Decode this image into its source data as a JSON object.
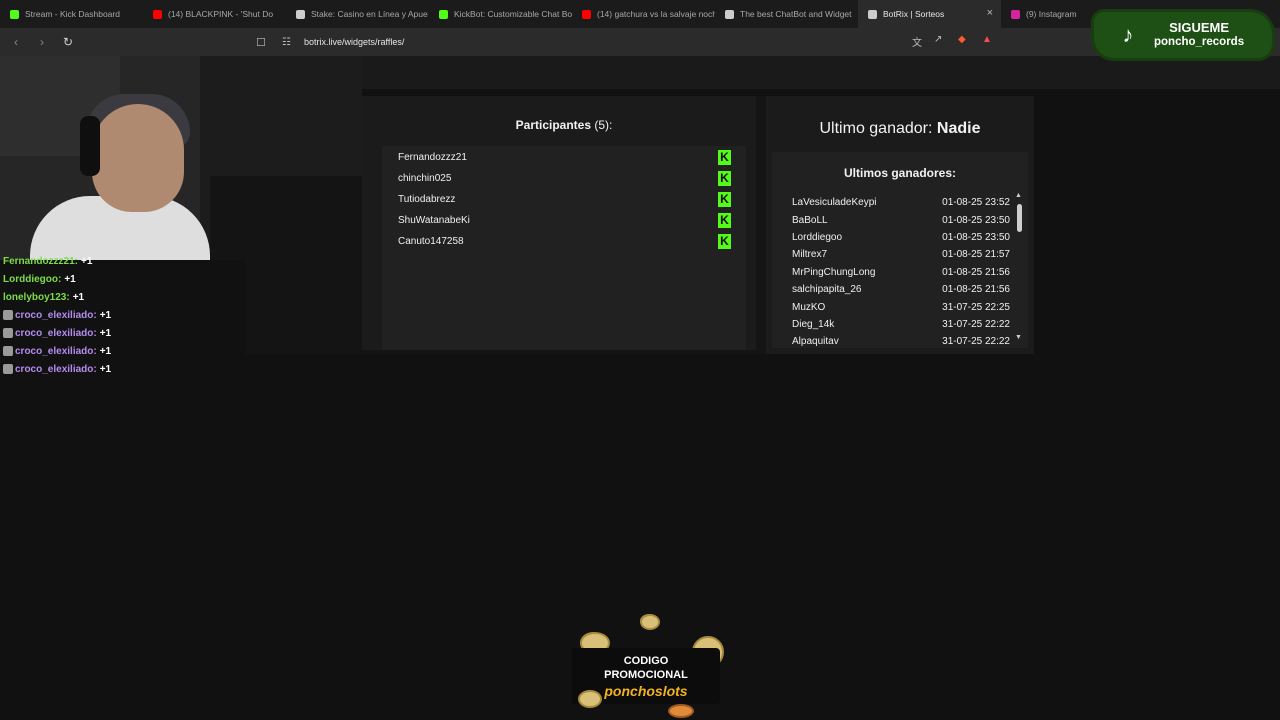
{
  "browser": {
    "tabs": [
      {
        "label": "Stream - Kick Dashboard",
        "icon": "kick-icon",
        "color": "#53fc18"
      },
      {
        "label": "(14) BLACKPINK - 'Shut Do",
        "icon": "youtube-icon",
        "color": "#ff0000"
      },
      {
        "label": "Stake: Casino en Línea y Apue",
        "icon": "stake-icon",
        "color": "#cccccc"
      },
      {
        "label": "KickBot: Customizable Chat Bo",
        "icon": "kickbot-icon",
        "color": "#53fc18"
      },
      {
        "label": "(14) gatchura vs la salvaje noch",
        "icon": "youtube-icon",
        "color": "#ff0000"
      },
      {
        "label": "The best ChatBot and Widget",
        "icon": "botrix-icon",
        "color": "#cccccc"
      },
      {
        "label": "BotRix | Sorteos",
        "icon": "botrix-icon",
        "color": "#cccccc",
        "active": true
      },
      {
        "label": "(9) Instagram",
        "icon": "instagram-icon",
        "color": "#d6249f"
      }
    ],
    "url": "botrix.live/widgets/raffles/"
  },
  "tiktok": {
    "line1": "SIGUEME",
    "line2": "poncho_records"
  },
  "chat": [
    {
      "user": "Fernandozzz21:",
      "count": "+1",
      "color": "green"
    },
    {
      "user": "Lorddiegoo:",
      "count": "+1",
      "color": "green"
    },
    {
      "user": "lonelyboy123:",
      "count": "+1",
      "color": "green"
    },
    {
      "user": "croco_elexiliado:",
      "count": "+1",
      "color": "purple",
      "badge": true
    },
    {
      "user": "croco_elexiliado:",
      "count": "+1",
      "color": "purple",
      "badge": true
    },
    {
      "user": "croco_elexiliado:",
      "count": "+1",
      "color": "purple",
      "badge": true
    },
    {
      "user": "croco_elexiliado:",
      "count": "+1",
      "color": "purple",
      "badge": true
    }
  ],
  "participants": {
    "title": "Participantes",
    "count": "(5):",
    "list": [
      "Fernandozzz21",
      "chinchin025",
      "Tutiodabrezz",
      "ShuWatanabeKi",
      "Canuto147258"
    ]
  },
  "winners": {
    "last_label": "Ultimo ganador:",
    "last_value": "Nadie",
    "subtitle": "Ultimos ganadores:",
    "list": [
      {
        "name": "LaVesiculadeKeypi",
        "date": "01-08-25 23:52"
      },
      {
        "name": "BaBoLL",
        "date": "01-08-25 23:50"
      },
      {
        "name": "Lorddiegoo",
        "date": "01-08-25 23:50"
      },
      {
        "name": "Miltrex7",
        "date": "01-08-25 21:57"
      },
      {
        "name": "MrPingChungLong",
        "date": "01-08-25 21:56"
      },
      {
        "name": "salchipapita_26",
        "date": "01-08-25 21:56"
      },
      {
        "name": "MuzKO",
        "date": "31-07-25 22:25"
      },
      {
        "name": "Dieg_14k",
        "date": "31-07-25 22:22"
      },
      {
        "name": "Alpaquitav",
        "date": "31-07-25 22:22"
      }
    ]
  },
  "promo": {
    "line1": "CODIGO",
    "line2": "PROMOCIONAL",
    "code": "ponchoslots"
  }
}
